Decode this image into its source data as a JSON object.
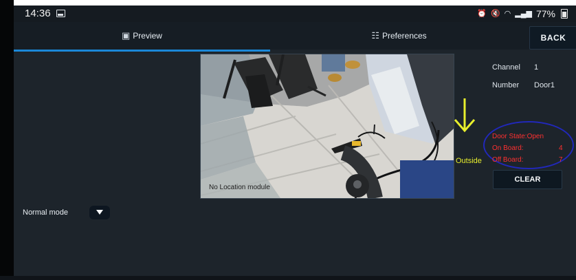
{
  "status_bar": {
    "time": "14:36",
    "battery": "77%"
  },
  "tabs": [
    {
      "label": "Preview"
    },
    {
      "label": "Preferences"
    }
  ],
  "back_label": "BACK",
  "camera": {
    "overlay_text": "No Location module"
  },
  "outside_label": "Outside",
  "info": {
    "channel_label": "Channel",
    "channel_value": "1",
    "number_label": "Number",
    "number_value": "Door1"
  },
  "counter": {
    "door_state": "Door State:Open",
    "on_board_label": "On Board:",
    "on_board_value": "4",
    "off_board_label": "Off Board:",
    "off_board_value": "7"
  },
  "clear_label": "CLEAR",
  "mode": {
    "selected": "Normal mode"
  },
  "colors": {
    "accent": "#1b88d9",
    "counter_text": "#ff3030",
    "annotation_ring": "#2128ba",
    "outside_arrow": "#e8ef2d"
  },
  "icons": [
    "image-icon",
    "alarm-icon",
    "mute-icon",
    "wifi-icon",
    "signal-icon",
    "battery-icon",
    "preview-icon",
    "preferences-icon",
    "down-arrow-icon",
    "chevron-down-icon"
  ]
}
